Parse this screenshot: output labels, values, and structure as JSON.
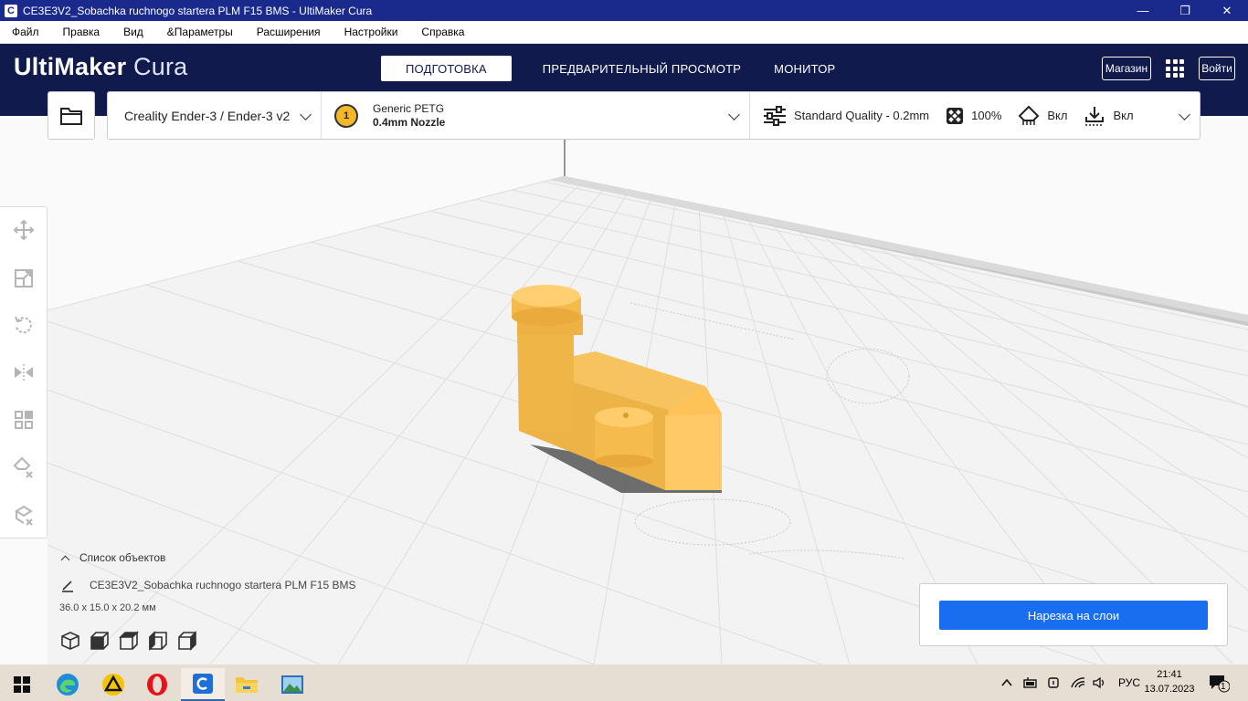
{
  "window": {
    "title": "CE3E3V2_Sobachka ruchnogo startera PLM F15 BMS - UltiMaker Cura",
    "app_icon_letter": "C",
    "minimize": "—",
    "restore": "❐",
    "close": "✕"
  },
  "menu": [
    "Файл",
    "Правка",
    "Вид",
    "&Параметры",
    "Расширения",
    "Настройки",
    "Справка"
  ],
  "header": {
    "logo_bold": "UltiMaker",
    "logo_light": "Cura",
    "tabs": [
      "ПОДГОТОВКА",
      "ПРЕДВАРИТЕЛЬНЫЙ ПРОСМОТР",
      "МОНИТОР"
    ],
    "marketplace": "Магазин",
    "signin": "Войти"
  },
  "settings": {
    "printer": "Creality Ender-3 / Ender-3 v2",
    "extruder_number": "1",
    "material": "Generic PETG",
    "nozzle": "0.4mm Nozzle",
    "quality": "Standard Quality - 0.2mm",
    "infill": "100%",
    "support": "Вкл",
    "adhesion": "Вкл"
  },
  "objects": {
    "header": "Список объектов",
    "item_name": "CE3E3V2_Sobachka ruchnogo startera PLM F15 BMS",
    "dimensions": "36.0 x 15.0 x 20.2 мм"
  },
  "slice": {
    "button": "Нарезка на слои"
  },
  "model_color": "#ffc257",
  "accent": "#196ef0",
  "taskbar": {
    "lang": "РУС",
    "time": "21:41",
    "date": "13.07.2023",
    "notification_count": "1"
  }
}
